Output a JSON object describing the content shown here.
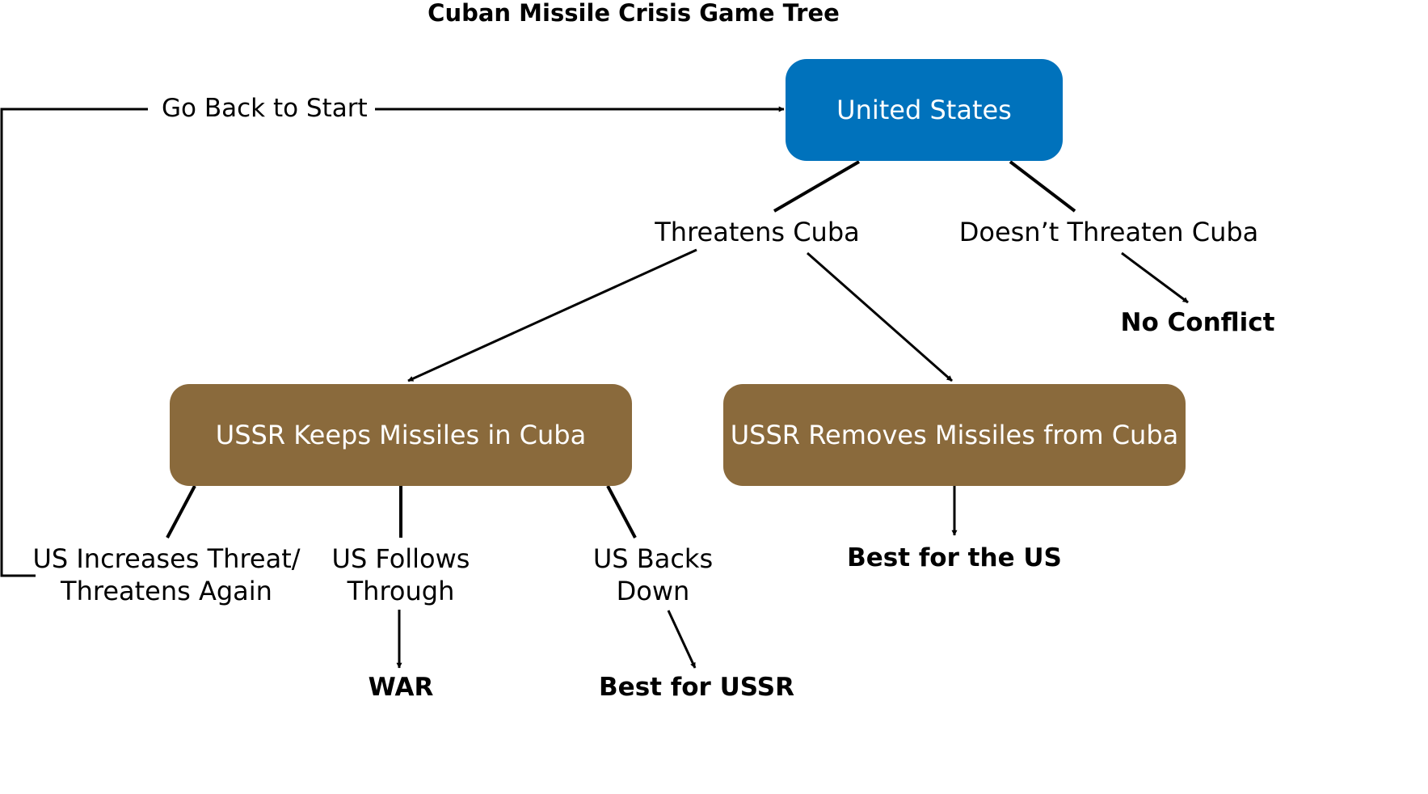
{
  "title": "Cuban Missile Crisis Game Tree",
  "colors": {
    "us_node": "#0072BC",
    "ussr_node": "#8A6A3C",
    "line": "#000000"
  },
  "nodes": {
    "united_states": "United States",
    "ussr_keeps": "USSR Keeps Missiles in Cuba",
    "ussr_removes": "USSR Removes Missiles from Cuba"
  },
  "choices": {
    "threatens": "Threatens Cuba",
    "doesnt_threaten": "Doesn’t Threaten Cuba",
    "increases_threat": "US Increases Threat/\nThreatens Again",
    "follows_through": "US Follows\nThrough",
    "backs_down": "US Backs\nDown"
  },
  "outcomes": {
    "no_conflict": "No Conflict",
    "war": "WAR",
    "best_ussr": "Best for USSR",
    "best_us": "Best for the US"
  },
  "loop_label": "Go Back to Start"
}
